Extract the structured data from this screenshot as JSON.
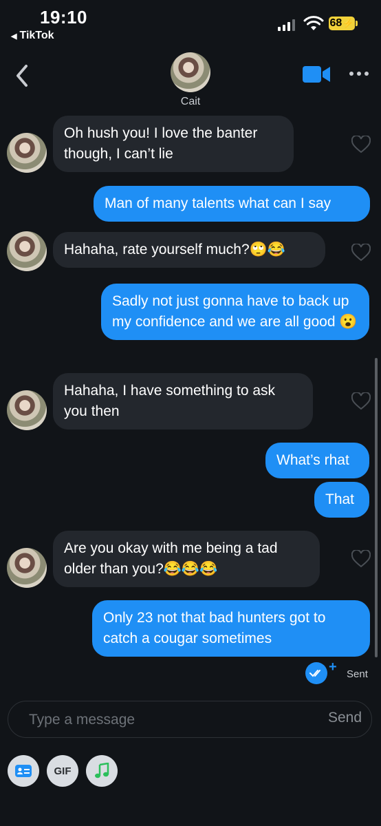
{
  "status_bar": {
    "time": "19:10",
    "back_app": "TikTok",
    "battery": "68"
  },
  "header": {
    "contact_name": "Cait",
    "icons": [
      "back-chevron-icon",
      "video-call-icon",
      "more-icon"
    ],
    "accent": "#1f8ff5"
  },
  "messages": [
    {
      "direction": "in",
      "text": "Oh hush you! I love the banter though, I can’t lie"
    },
    {
      "direction": "out",
      "text": "Man of many talents what can I say"
    },
    {
      "direction": "in",
      "text": "Hahaha, rate yourself much?🙄😂"
    },
    {
      "direction": "out",
      "text": "Sadly not just gonna have to back up my confidence and we are all good 😮"
    },
    {
      "direction": "in",
      "text": "Hahaha, I have something to ask you then"
    },
    {
      "direction": "out",
      "text": "What’s rhat"
    },
    {
      "direction": "out",
      "text": "That"
    },
    {
      "direction": "in",
      "text": "Are you okay with me being a tad older than you?😂😂😂"
    },
    {
      "direction": "out",
      "text": "Only 23 not that bad hunters got to catch a cougar sometimes"
    }
  ],
  "receipt": {
    "label": "Sent"
  },
  "composer": {
    "placeholder": "Type a message",
    "send_label": "Send"
  },
  "toolbar": {
    "gif_label": "GIF",
    "icons": [
      "card-icon",
      "gif-icon",
      "music-icon"
    ]
  },
  "colors": {
    "background": "#111418",
    "incoming_bubble": "#23272d",
    "outgoing_bubble": "#1f8ff5"
  }
}
